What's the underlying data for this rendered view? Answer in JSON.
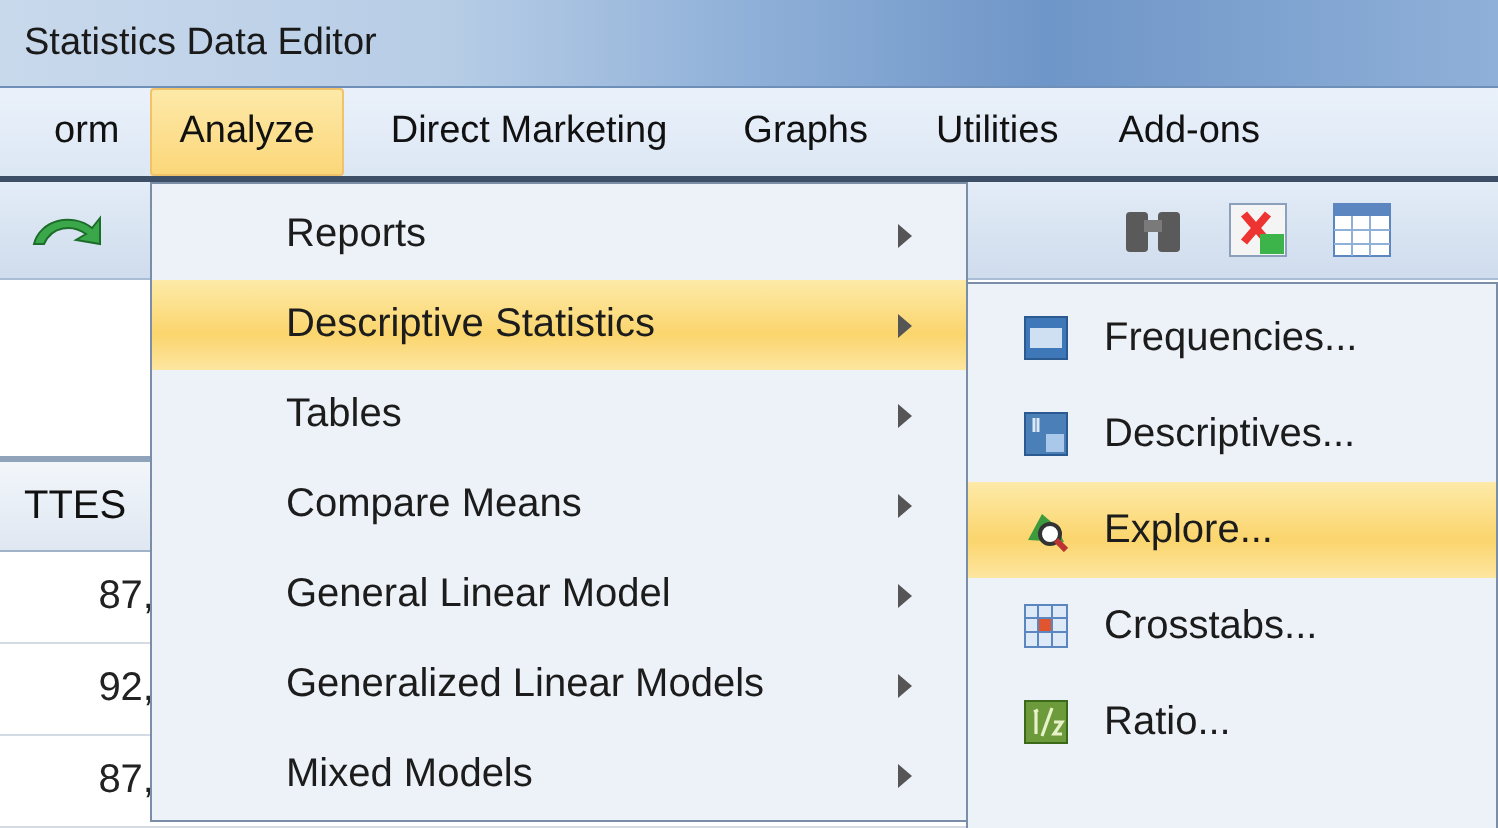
{
  "window": {
    "title": "Statistics Data Editor"
  },
  "menubar": [
    {
      "label": "orm",
      "selected": false
    },
    {
      "label": "Analyze",
      "selected": true
    },
    {
      "label": "Direct Marketing",
      "selected": false
    },
    {
      "label": "Graphs",
      "selected": false
    },
    {
      "label": "Utilities",
      "selected": false
    },
    {
      "label": "Add-ons",
      "selected": false
    }
  ],
  "data_view": {
    "column_header": "TTES",
    "cells": [
      "87,",
      "92,",
      "87,"
    ]
  },
  "analyze_menu": [
    {
      "label": "Reports",
      "selected": false,
      "submenu": true
    },
    {
      "label": "Descriptive Statistics",
      "selected": true,
      "submenu": true
    },
    {
      "label": "Tables",
      "selected": false,
      "submenu": true
    },
    {
      "label": "Compare Means",
      "selected": false,
      "submenu": true
    },
    {
      "label": "General Linear Model",
      "selected": false,
      "submenu": true
    },
    {
      "label": "Generalized Linear Models",
      "selected": false,
      "submenu": true
    },
    {
      "label": "Mixed Models",
      "selected": false,
      "submenu": true
    }
  ],
  "descriptive_submenu": [
    {
      "label": "Frequencies...",
      "selected": false,
      "kind": "frequencies"
    },
    {
      "label": "Descriptives...",
      "selected": false,
      "kind": "descriptives"
    },
    {
      "label": "Explore...",
      "selected": true,
      "kind": "explore"
    },
    {
      "label": "Crosstabs...",
      "selected": false,
      "kind": "crosstabs"
    },
    {
      "label": "Ratio...",
      "selected": false,
      "kind": "ratio"
    }
  ]
}
